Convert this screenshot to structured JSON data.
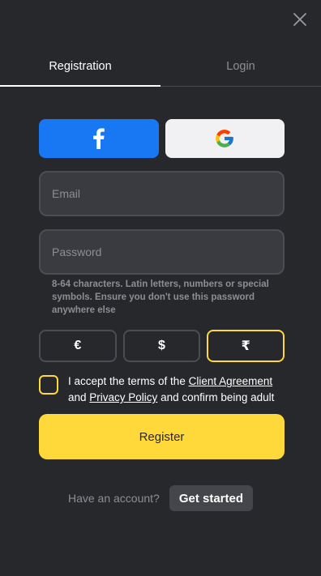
{
  "tabs": [
    {
      "label": "Registration",
      "active": true
    },
    {
      "label": "Login",
      "active": false
    }
  ],
  "social": {
    "facebook_icon": "facebook-icon",
    "google_icon": "google-icon"
  },
  "form": {
    "email_placeholder": "Email",
    "password_placeholder": "Password",
    "password_hint": "8-64 characters. Latin letters, numbers or special symbols. Ensure you don't use this password anywhere else"
  },
  "currencies": [
    {
      "symbol": "€",
      "selected": false
    },
    {
      "symbol": "$",
      "selected": false
    },
    {
      "symbol": "₹",
      "selected": true
    }
  ],
  "terms": {
    "prefix": "I accept the terms of the ",
    "client_agreement": "Client Agreement",
    "and": " and ",
    "privacy_policy": "Privacy Policy",
    "suffix": " and confirm being adult"
  },
  "register_label": "Register",
  "footer": {
    "text": "Have an account?",
    "button": "Get started"
  },
  "colors": {
    "background": "#27282c",
    "accent": "#ffd83a",
    "facebook": "#1877f2"
  }
}
